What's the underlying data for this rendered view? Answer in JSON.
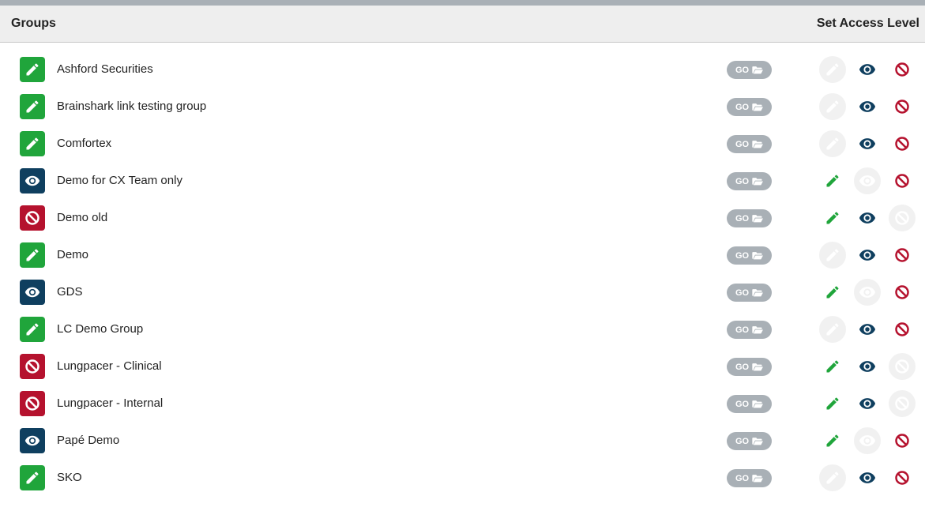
{
  "header": {
    "title": "Groups",
    "access_title": "Set Access Level"
  },
  "colors": {
    "edit": "#20a53b",
    "view": "#0f3f5f",
    "none": "#b5122e",
    "disabled": "#ffffff",
    "go_bg": "#a9b0b6"
  },
  "go_label": "GO",
  "groups": [
    {
      "name": "Ashford Securities",
      "level": "edit"
    },
    {
      "name": "Brainshark link testing group",
      "level": "edit"
    },
    {
      "name": "Comfortex",
      "level": "edit"
    },
    {
      "name": "Demo for CX Team only",
      "level": "view"
    },
    {
      "name": "Demo old",
      "level": "none"
    },
    {
      "name": "Demo",
      "level": "edit"
    },
    {
      "name": "GDS",
      "level": "view"
    },
    {
      "name": "LC Demo Group",
      "level": "edit"
    },
    {
      "name": "Lungpacer - Clinical",
      "level": "none"
    },
    {
      "name": "Lungpacer - Internal",
      "level": "none"
    },
    {
      "name": "Papé Demo",
      "level": "view"
    },
    {
      "name": "SKO",
      "level": "edit"
    }
  ]
}
